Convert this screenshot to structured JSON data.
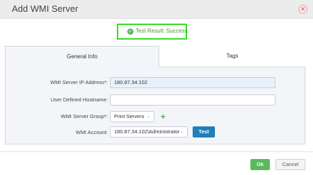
{
  "dialog": {
    "title": "Add WMI Server",
    "close_glyph": "✕"
  },
  "test_result": {
    "text": "Test Result: Success.",
    "icon": "check-circle-icon",
    "glyph": "✓"
  },
  "tabs": [
    {
      "label": "General Info",
      "active": true
    },
    {
      "label": "Tags",
      "active": false
    }
  ],
  "form": {
    "ip_label": "WMI Server IP Address*:",
    "ip_value": "180.87.34.102",
    "hostname_label": "User Defined Hostname:",
    "hostname_value": "",
    "group_label": "WMI Server Group*:",
    "group_value": "Print Servers",
    "add_glyph": "+",
    "account_label": "WMI Account:",
    "account_value": "180.87.34.102\\Administrator",
    "test_label": "Test",
    "chevron_glyph": "⌄"
  },
  "footer": {
    "ok_label": "Ok",
    "cancel_label": "Cancel"
  },
  "colors": {
    "success_highlight": "#33dd22",
    "primary_button": "#1f7fb8",
    "ok_button": "#5cb85c",
    "close": "#d9534f"
  }
}
